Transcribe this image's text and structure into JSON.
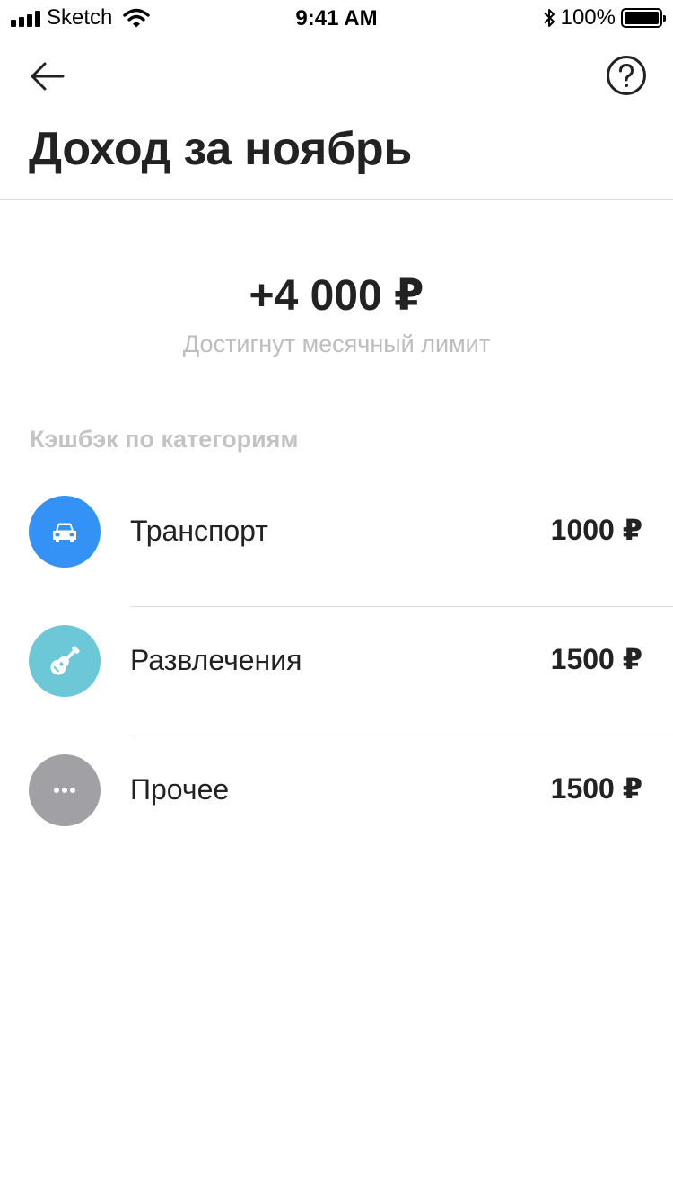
{
  "status_bar": {
    "carrier": "Sketch",
    "time": "9:41 AM",
    "battery": "100%"
  },
  "nav": {
    "back_icon": "arrow-left-icon",
    "help_icon": "question-circle-icon"
  },
  "page": {
    "title": "Доход за ноябрь",
    "total_amount": "+4 000 ₽",
    "limit_note": "Достигнут месячный лимит",
    "section_title": "Кэшбэк по категориям"
  },
  "categories": [
    {
      "label": "Транспорт",
      "value": "1000 ₽",
      "icon": "car-icon",
      "color": "#3492f7"
    },
    {
      "label": "Развлечения",
      "value": "1500 ₽",
      "icon": "guitar-icon",
      "color": "#6cc8d6"
    },
    {
      "label": "Прочее",
      "value": "1500 ₽",
      "icon": "more-dots-icon",
      "color": "#a0a0a5"
    }
  ]
}
